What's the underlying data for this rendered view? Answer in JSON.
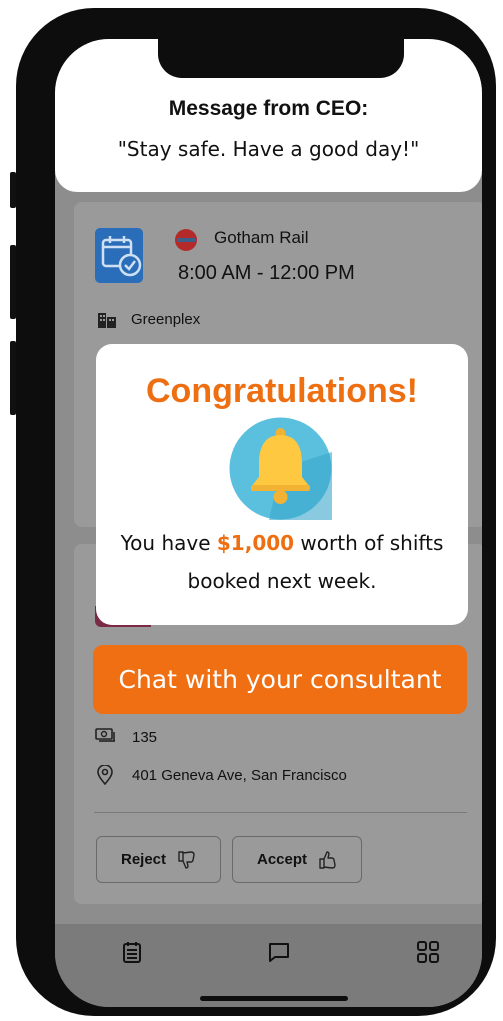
{
  "ceo": {
    "title": "Message from CEO:",
    "message": "\"Stay safe. Have a good day!\""
  },
  "shift": {
    "company": "Gotham Rail",
    "time": "8:00 AM - 12:00 PM",
    "site": "Greenplex",
    "count": "135",
    "address": "401 Geneva Ave, San Francisco"
  },
  "actions": {
    "reject": "Reject",
    "accept": "Accept"
  },
  "popup": {
    "title": "Congratulations!",
    "message_before": "You have ",
    "amount": "$1,000",
    "message_after": " worth of shifts booked next week."
  },
  "chat": {
    "label": "Chat with your consultant"
  },
  "icons": {
    "calendar": "calendar-check-icon",
    "building": "building-icon",
    "money": "money-icon",
    "location": "location-pin-icon",
    "thumbs_down": "thumbs-down-icon",
    "thumbs_up": "thumbs-up-icon",
    "bell": "bell-icon",
    "nav": [
      "schedule-icon",
      "chat-icon",
      "grid-icon"
    ]
  },
  "colors": {
    "accent": "#f06f12",
    "calendar": "#2a6db8",
    "bell_circle": "#5bc0de",
    "bell": "#fec840"
  }
}
